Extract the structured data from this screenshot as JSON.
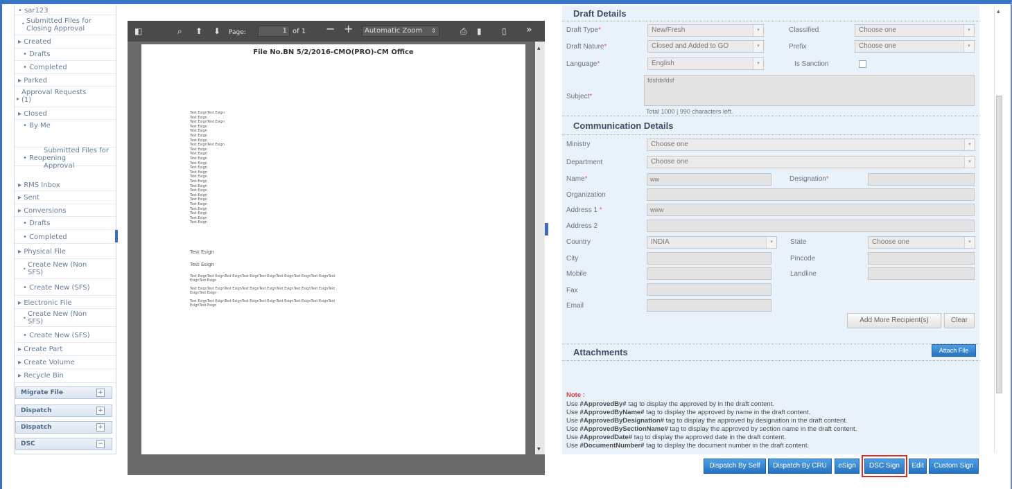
{
  "sidebar": {
    "items": [
      {
        "label": "• sar123"
      },
      {
        "label": "Submitted Files for",
        "label2": "Closing Approval"
      },
      {
        "label": "▸ Created"
      },
      {
        "label": "• Drafts"
      },
      {
        "label": "• Completed"
      },
      {
        "label": "▸ Parked"
      },
      {
        "label": "Approval Requests",
        "label2": "(1)"
      },
      {
        "label": "▸ Closed"
      },
      {
        "label": "• By Me"
      },
      {
        "label": "Submitted Files for",
        "label2": "• Reopening",
        "label3": "Approval"
      },
      {
        "label": "▸ RMS Inbox"
      },
      {
        "label": "▸ Sent"
      },
      {
        "label": "▸ Conversions"
      },
      {
        "label": "• Drafts"
      },
      {
        "label": "• Completed"
      },
      {
        "label": "▸ Physical File"
      },
      {
        "label": "Create New (Non",
        "label2": "SFS)"
      },
      {
        "label": "• Create New (SFS)"
      },
      {
        "label": "▸ Electronic File"
      },
      {
        "label": "Create New (Non",
        "label2": "SFS)"
      },
      {
        "label": "• Create New (SFS)"
      },
      {
        "label": "▸ Create Part"
      },
      {
        "label": "▸ Create Volume"
      },
      {
        "label": "▸ Recycle Bin"
      }
    ],
    "boxes": [
      "Migrate File",
      "Dispatch",
      "Dispatch",
      "DSC"
    ]
  },
  "pdf": {
    "page_label": "Page:",
    "page_value": "1",
    "page_of": "of 1",
    "zoom": "Automatic Zoom",
    "file_no": "File No.BN 5/2/2016-CMO(PRO)-CM Office",
    "lines": [
      "Test EsignTest Esign",
      "Test Esign",
      "Test EsignTest Esign",
      "Test Esign",
      "Test Esign",
      "Test Esign",
      "Test Esign",
      "Test EsignTest Esign",
      "Test Esign",
      "Test Esign",
      "Test Esign",
      "Test Esign",
      "Test Esign",
      "Test Esign",
      " Test Esign",
      "Test Esign",
      "Test Esign",
      "Test Esign",
      "Test Esign",
      "Test Esign",
      "Test Esign",
      "Test Esign",
      " Test Esign",
      "Test Esign",
      "Test Esign"
    ],
    "line_a": "Test Esign",
    "line_b": "Test Esign",
    "long1": "Test EsignTest EsignTest EsignTest EsignTest EsignTest EsignTest EsignTest EsignTest",
    "long2": "EsignTest Esign",
    "long3": "Test EsignTest EsignTest EsignTest EsignTest EsignTest EsignTest EsignTest EsignTest",
    "long4": "EsignTest Esign",
    "long5": "Test EsignTest EsignTest EsignTest EsignTest EsignTest EsignTest EsignTest EsignTest",
    "long6": "EsignTest Esign"
  },
  "draft": {
    "title": "Draft Details",
    "draft_type_label": "Draft Type",
    "draft_type_value": "New/Fresh",
    "classified_label": "Classified",
    "classified_value": "Choose one",
    "draft_nature_label": "Draft Nature",
    "draft_nature_value": "Closed and Added to GO",
    "prefix_label": "Prefix",
    "prefix_value": "Choose one",
    "language_label": "Language",
    "language_value": "English",
    "sanction_label": "Is Sanction",
    "subject_label": "Subject",
    "subject_value": "fdsfdsfdsf",
    "char_count": "Total 1000  |  990  characters left."
  },
  "comm": {
    "title": "Communication Details",
    "ministry_label": "Ministry",
    "ministry_value": "Choose one",
    "department_label": "Department",
    "department_value": "Choose one",
    "name_label": "Name",
    "name_value": "ww",
    "designation_label": "Designation",
    "organization_label": "Organization",
    "address1_label": "Address 1",
    "address1_value": "www",
    "address2_label": "Address 2",
    "country_label": "Country",
    "country_value": "INDIA",
    "state_label": "State",
    "state_value": "Choose one",
    "city_label": "City",
    "pincode_label": "Pincode",
    "mobile_label": "Mobile",
    "landline_label": "Landline",
    "fax_label": "Fax",
    "email_label": "Email",
    "add_more": "Add More Recipient(s)",
    "clear": "Clear"
  },
  "attach": {
    "title": "Attachments",
    "attach_btn": "Attach File"
  },
  "notes": {
    "title": "Note :",
    "lines": [
      {
        "pre": "Use ",
        "tag": "#ApprovedBy#",
        "post": " tag to display the approved by in the draft content."
      },
      {
        "pre": "Use ",
        "tag": "#ApprovedByName#",
        "post": " tag to display the approved by name in the draft content."
      },
      {
        "pre": "Use ",
        "tag": "#ApprovedByDesignation#",
        "post": " tag to display the approved by designation in the draft content."
      },
      {
        "pre": "Use ",
        "tag": "#ApprovedBySectionName#",
        "post": " tag to display the approved by section name in the draft content."
      },
      {
        "pre": "Use ",
        "tag": "#ApprovedDate#",
        "post": " tag to display the approved date in the draft content."
      },
      {
        "pre": "Use ",
        "tag": "#DocumentNumber#",
        "post": " tag to display the document number in the draft content."
      }
    ]
  },
  "actions": {
    "dispatch_self": "Dispatch By Self",
    "dispatch_cru": "Dispatch By CRU",
    "esign": "eSign",
    "dsc_sign": "DSC Sign",
    "edit": "Edit",
    "custom_sign": "Custom Sign"
  },
  "colors": {
    "accent": "#2574c4",
    "frame": "#3a72c4",
    "highlight": "#d42c2c",
    "required": "#e05b5b"
  }
}
